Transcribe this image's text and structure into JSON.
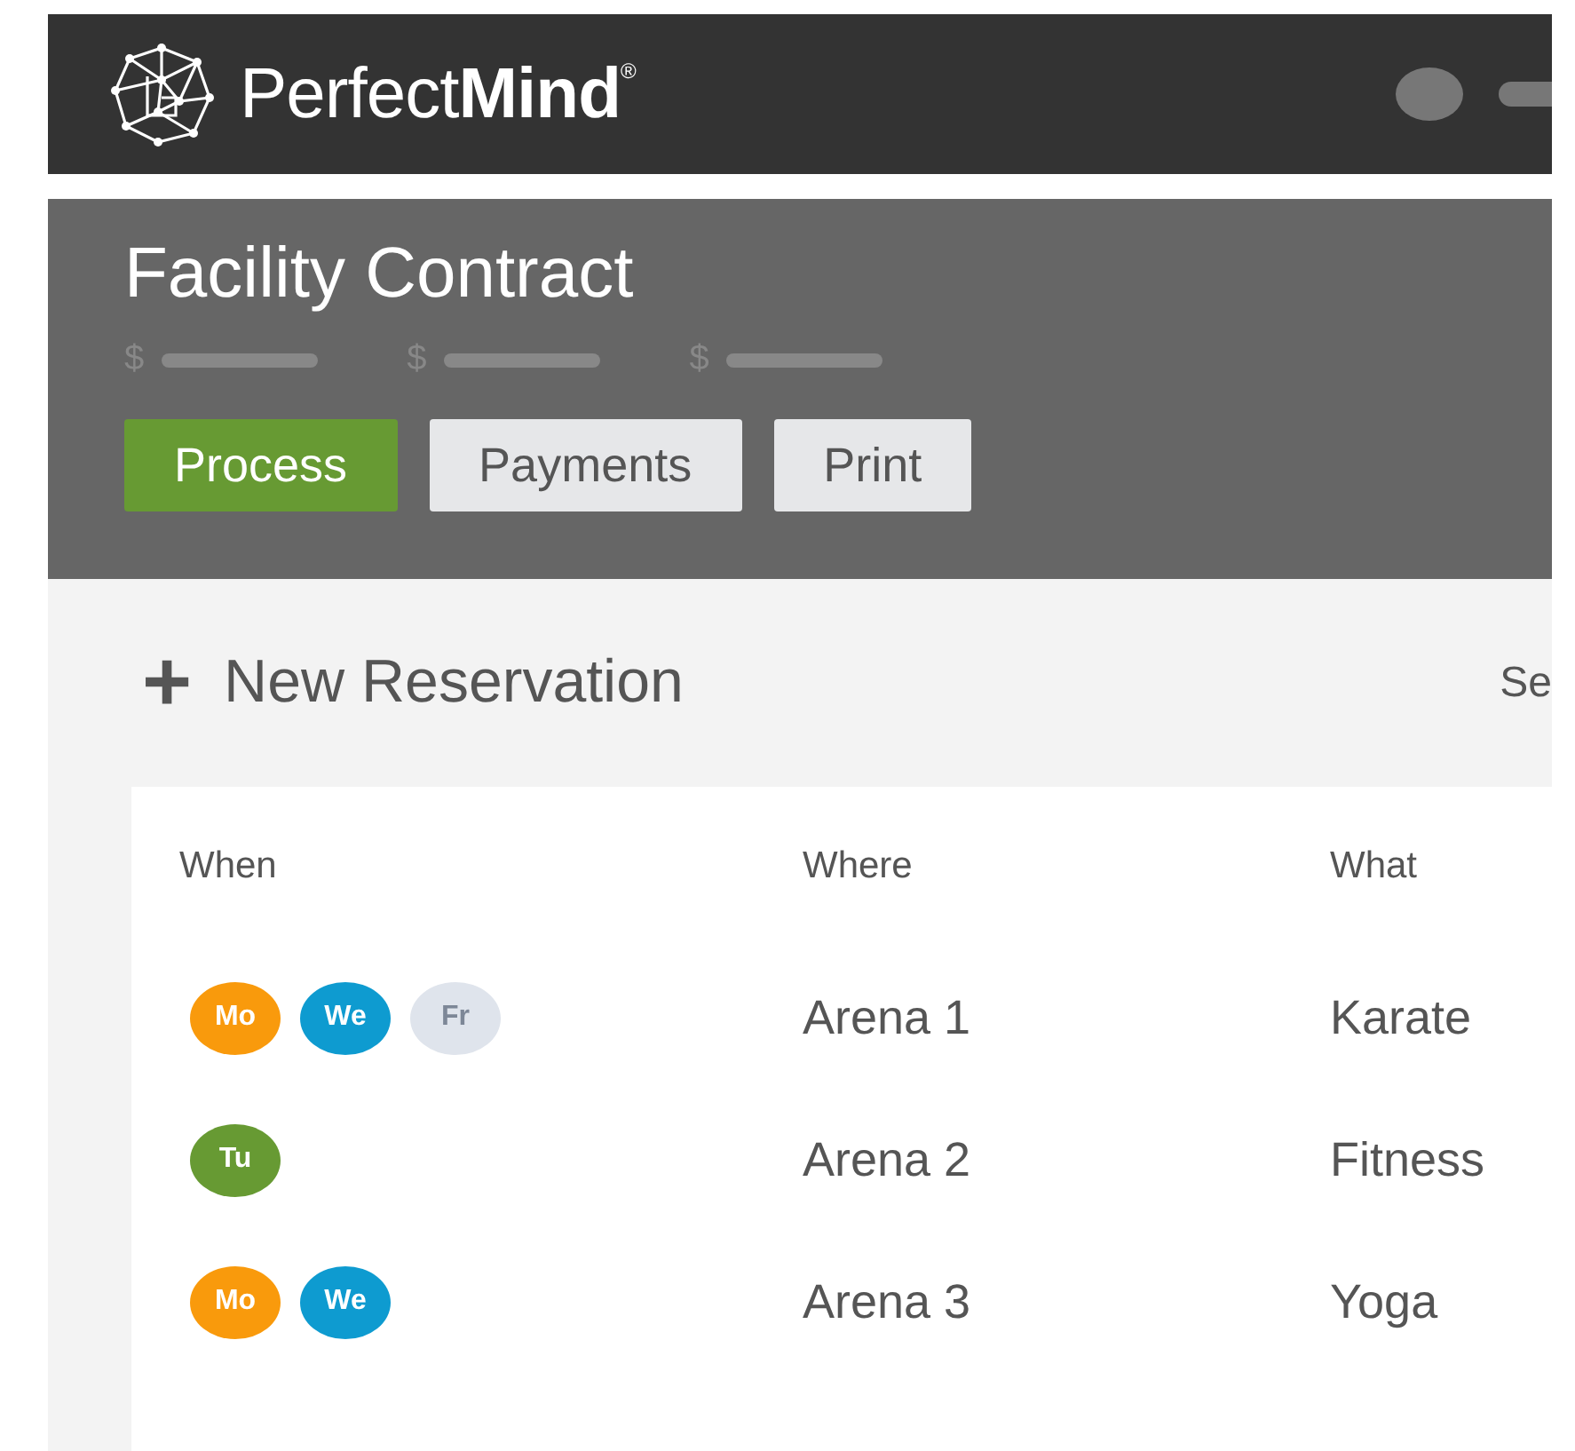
{
  "header": {
    "logo": "Perfect**Mind**$^{®}$"
  },
  "contract": {
    "title": "Facility Contract",
    "amounts": [
      "$",
      "$",
      "$"
    ],
    "buttons": [
      {
        "label": "Process",
        "kind": "primary"
      },
      {
        "label": "Payments",
        "kind": "secondary"
      },
      {
        "label": "Print",
        "kind": "secondary"
      }
    ]
  },
  "new_reservation": {
    "icon": "+",
    "label": "New Reservation",
    "right_text": "Se"
  },
  "table": {
    "columns": [
      "When",
      "Where",
      "What"
    ],
    "rows": [
      {
        "days": [
          {
            "label": "Mo",
            "color": "#f99a0c"
          },
          {
            "label": "We",
            "color": "#0e9bd0"
          },
          {
            "label": "Fr",
            "color": "#dfe4ec"
          }
        ],
        "where": "Arena 1",
        "what": "Karate"
      },
      {
        "days": [
          {
            "label": "Tu",
            "color": "#679a33"
          }
        ],
        "where": "Arena 2",
        "what": "Fitness"
      },
      {
        "days": [
          {
            "label": "Mo",
            "color": "#f99a0c"
          },
          {
            "label": "We",
            "color": "#0e9bd0"
          }
        ],
        "where": "Arena 3",
        "what": "Yoga"
      }
    ]
  }
}
